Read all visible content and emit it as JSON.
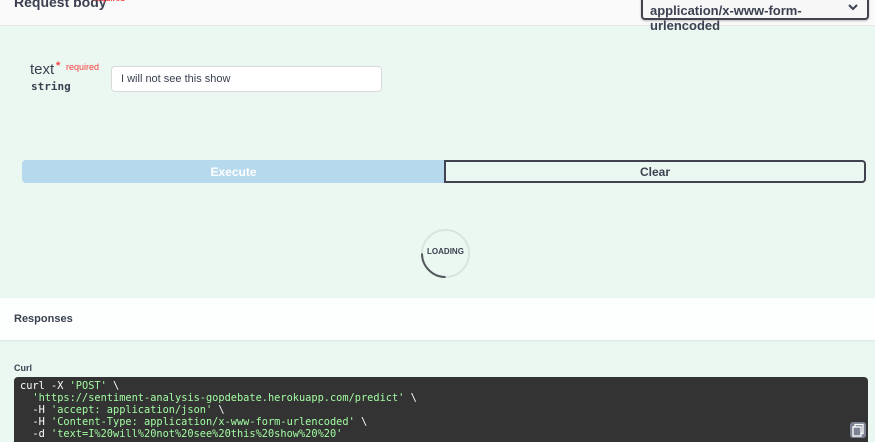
{
  "request_body": {
    "title": "Request body",
    "required": "required",
    "content_type": "application/x-www-form-urlencoded"
  },
  "param": {
    "name": "text",
    "star": "*",
    "required": "required",
    "type": "string",
    "value": "I will not see this show"
  },
  "buttons": {
    "execute": "Execute",
    "clear": "Clear"
  },
  "loading": {
    "text": "LOADING"
  },
  "responses": {
    "title": "Responses"
  },
  "curl": {
    "label": "Curl",
    "line1_pre": "curl -X ",
    "line1_str": "'POST'",
    "line1_post": " \\",
    "line2_pre": "  ",
    "line2_str": "'https://sentiment-analysis-gopdebate.herokuapp.com/predict'",
    "line2_post": " \\",
    "line3_pre": "  -H ",
    "line3_str": "'accept: application/json'",
    "line3_post": " \\",
    "line4_pre": "  -H ",
    "line4_str": "'Content-Type: application/x-www-form-urlencoded'",
    "line4_post": " \\",
    "line5_pre": "  -d ",
    "line5_str": "'text=I%20will%20not%20see%20this%20show%20%20'",
    "line5_post": ""
  },
  "colors": {
    "background": "#ebf8f1",
    "execute_disabled": "#b7d9ee",
    "required_red": "#f93e3e",
    "curl_bg": "#333333",
    "curl_string": "#a2fca2"
  },
  "icons": {
    "select_chevron": "chevron-down-icon",
    "copy": "copy-icon"
  }
}
